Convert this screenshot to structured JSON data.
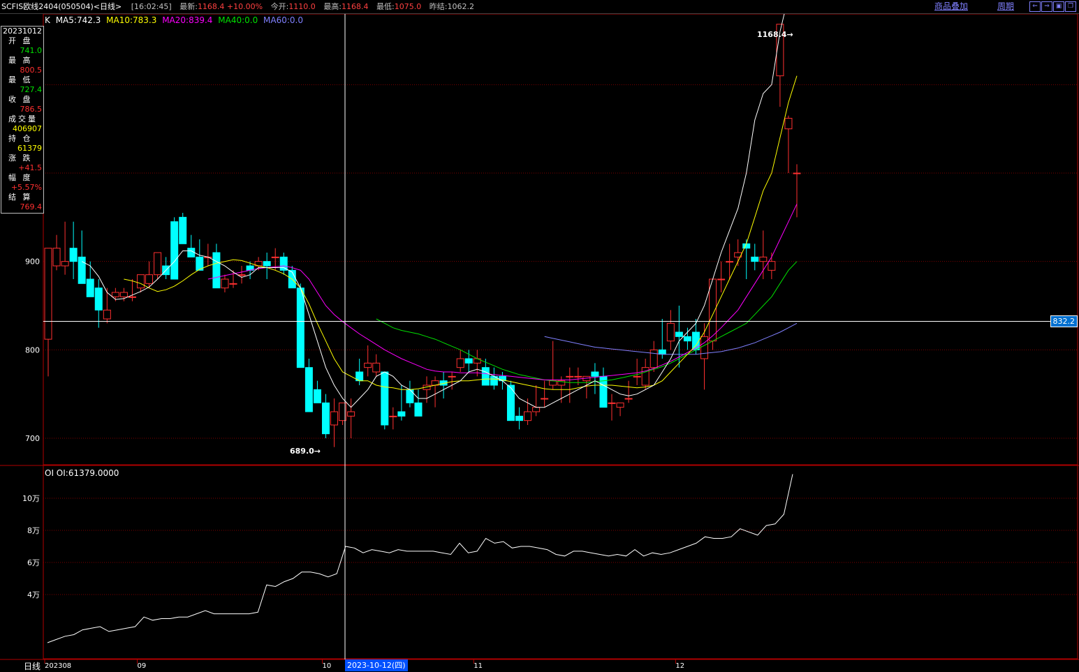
{
  "topbar": {
    "title": "SCFIS欧线2404(050504)<日线>",
    "time": "[16:02:45]",
    "latest_label": "最新:",
    "latest_value": "1168.4 +10.00%",
    "open_label": "今开:",
    "open_value": "1110.0",
    "high_label": "最高:",
    "high_value": "1168.4",
    "low_label": "最低:",
    "low_value": "1075.0",
    "prev_label": "昨结:",
    "prev_value": "1062.2",
    "link_overlay": "商品叠加",
    "link_period": "周期"
  },
  "infobox": {
    "date": "20231012",
    "fields": [
      {
        "label": "开 盘",
        "value": "741.0",
        "color": "green"
      },
      {
        "label": "最 高",
        "value": "800.5",
        "color": "red"
      },
      {
        "label": "最 低",
        "value": "727.4",
        "color": "green"
      },
      {
        "label": "收 盘",
        "value": "786.5",
        "color": "red"
      },
      {
        "label": "成交量",
        "value": "406907",
        "color": "yellow"
      },
      {
        "label": "持 仓",
        "value": "61379",
        "color": "yellow"
      },
      {
        "label": "涨 跌",
        "value": "+41.5",
        "color": "red"
      },
      {
        "label": "幅 度",
        "value": "+5.57%",
        "color": "red"
      },
      {
        "label": "结 算",
        "value": "769.4",
        "color": "red"
      }
    ]
  },
  "ma_legend": {
    "k": "K",
    "ma5": "MA5:742.3",
    "ma10": "MA10:783.3",
    "ma20": "MA20:839.4",
    "ma40": "MA40:0.0",
    "ma60": "MA60:0.0",
    "colors": {
      "ma5": "#ffffff",
      "ma10": "#ffff00",
      "ma20": "#ff00ff",
      "ma40": "#00e000",
      "ma60": "#8080ff"
    }
  },
  "oi_legend": "OI OI:61379.0000",
  "cursor_price": "832.2",
  "cursor_date": "2023-10-12(四)",
  "period_label": "日线",
  "max_label": "1168.4",
  "min_label": "689.0",
  "price_ticks": [
    "900",
    "800",
    "700"
  ],
  "oi_ticks": [
    "10万",
    "8万",
    "6万",
    "4万"
  ],
  "x_ticks": [
    "202308",
    "09",
    "10",
    "11",
    "12"
  ],
  "chart_data": {
    "type": "candlestick",
    "title": "",
    "candles": [
      [
        812,
        915,
        770,
        915
      ],
      [
        895,
        930,
        890,
        915
      ],
      [
        895,
        945,
        885,
        900
      ],
      [
        915,
        945,
        880,
        900
      ],
      [
        905,
        935,
        880,
        875
      ],
      [
        880,
        900,
        860,
        860
      ],
      [
        870,
        880,
        825,
        845
      ],
      [
        835,
        870,
        830,
        845
      ],
      [
        860,
        870,
        855,
        865
      ],
      [
        860,
        870,
        855,
        865
      ],
      [
        860,
        880,
        855,
        860
      ],
      [
        870,
        880,
        865,
        885
      ],
      [
        875,
        900,
        870,
        885
      ],
      [
        885,
        910,
        880,
        910
      ],
      [
        895,
        905,
        880,
        885
      ],
      [
        945,
        950,
        880,
        880
      ],
      [
        950,
        955,
        925,
        920
      ],
      [
        915,
        930,
        905,
        905
      ],
      [
        905,
        925,
        890,
        890
      ],
      [
        905,
        920,
        895,
        905
      ],
      [
        910,
        920,
        870,
        870
      ],
      [
        870,
        885,
        865,
        880
      ],
      [
        875,
        890,
        870,
        875
      ],
      [
        885,
        895,
        875,
        885
      ],
      [
        895,
        900,
        880,
        890
      ],
      [
        895,
        905,
        890,
        900
      ],
      [
        900,
        910,
        880,
        895
      ],
      [
        905,
        915,
        890,
        905
      ],
      [
        905,
        910,
        885,
        890
      ],
      [
        890,
        895,
        870,
        870
      ],
      [
        870,
        875,
        780,
        780
      ],
      [
        780,
        790,
        730,
        730
      ],
      [
        755,
        765,
        740,
        740
      ],
      [
        740,
        750,
        700,
        705
      ],
      [
        715,
        745,
        690,
        730
      ],
      [
        720,
        740,
        715,
        740
      ],
      [
        725,
        745,
        700,
        730
      ],
      [
        775,
        790,
        760,
        765
      ],
      [
        780,
        805,
        770,
        785
      ],
      [
        775,
        795,
        770,
        785
      ],
      [
        775,
        775,
        710,
        715
      ],
      [
        725,
        735,
        710,
        725
      ],
      [
        730,
        760,
        720,
        725
      ],
      [
        755,
        765,
        735,
        740
      ],
      [
        740,
        755,
        725,
        725
      ],
      [
        755,
        770,
        740,
        760
      ],
      [
        760,
        770,
        735,
        765
      ],
      [
        765,
        775,
        745,
        760
      ],
      [
        770,
        775,
        755,
        770
      ],
      [
        780,
        800,
        775,
        790
      ],
      [
        790,
        800,
        775,
        785
      ],
      [
        785,
        800,
        770,
        790
      ],
      [
        780,
        790,
        760,
        760
      ],
      [
        770,
        780,
        755,
        760
      ],
      [
        770,
        775,
        755,
        765
      ],
      [
        760,
        765,
        725,
        720
      ],
      [
        725,
        735,
        710,
        720
      ],
      [
        720,
        745,
        715,
        730
      ],
      [
        730,
        760,
        725,
        735
      ],
      [
        745,
        765,
        735,
        745
      ],
      [
        760,
        810,
        755,
        765
      ],
      [
        760,
        770,
        740,
        765
      ],
      [
        770,
        780,
        740,
        770
      ],
      [
        770,
        780,
        760,
        770
      ],
      [
        765,
        770,
        745,
        770
      ],
      [
        775,
        785,
        750,
        770
      ],
      [
        770,
        780,
        740,
        735
      ],
      [
        740,
        750,
        720,
        740
      ],
      [
        735,
        740,
        725,
        740
      ],
      [
        745,
        765,
        740,
        745
      ],
      [
        770,
        790,
        760,
        770
      ],
      [
        760,
        790,
        755,
        780
      ],
      [
        780,
        810,
        775,
        800
      ],
      [
        800,
        835,
        790,
        795
      ],
      [
        810,
        845,
        800,
        830
      ],
      [
        820,
        850,
        780,
        815
      ],
      [
        815,
        825,
        800,
        810
      ],
      [
        820,
        835,
        795,
        800
      ],
      [
        790,
        830,
        755,
        815
      ],
      [
        810,
        880,
        800,
        880
      ],
      [
        880,
        900,
        865,
        880
      ],
      [
        900,
        920,
        880,
        900
      ],
      [
        905,
        925,
        895,
        910
      ],
      [
        920,
        925,
        880,
        915
      ],
      [
        905,
        920,
        890,
        900
      ],
      [
        900,
        935,
        880,
        905
      ],
      [
        890,
        910,
        880,
        900
      ],
      [
        1110,
        1168.4,
        1075,
        1168.4
      ],
      [
        1050,
        1065,
        1000,
        1062
      ],
      [
        1000,
        1010,
        950,
        1000
      ]
    ],
    "ma5": [
      null,
      null,
      null,
      null,
      900,
      895,
      883,
      865,
      857,
      858,
      862,
      866,
      871,
      880,
      890,
      900,
      912,
      912,
      907,
      905,
      900,
      895,
      888,
      882,
      885,
      893,
      893,
      893,
      893,
      888,
      870,
      840,
      810,
      780,
      760,
      745,
      735,
      745,
      755,
      770,
      775,
      770,
      760,
      755,
      745,
      745,
      750,
      755,
      760,
      765,
      775,
      778,
      775,
      770,
      765,
      757,
      745,
      740,
      735,
      735,
      740,
      745,
      750,
      755,
      760,
      765,
      760,
      755,
      750,
      748,
      750,
      755,
      760,
      775,
      790,
      810,
      820,
      830,
      850,
      880,
      910,
      935,
      960,
      1000,
      1060,
      1090,
      1100,
      1160,
      1200,
      1210
    ],
    "ma10": [
      null,
      null,
      null,
      null,
      null,
      null,
      null,
      null,
      null,
      880,
      878,
      875,
      870,
      866,
      868,
      872,
      878,
      885,
      891,
      895,
      898,
      900,
      902,
      901,
      898,
      895,
      893,
      890,
      886,
      880,
      870,
      852,
      830,
      810,
      790,
      775,
      770,
      765,
      765,
      760,
      758,
      757,
      755,
      755,
      756,
      758,
      760,
      762,
      764,
      765,
      765,
      766,
      767,
      767,
      766,
      764,
      762,
      760,
      758,
      756,
      755,
      755,
      755,
      757,
      759,
      760,
      760,
      760,
      759,
      758,
      757,
      758,
      760,
      765,
      775,
      785,
      795,
      805,
      820,
      840,
      860,
      880,
      900,
      920,
      950,
      980,
      1000,
      1040,
      1080,
      1110
    ],
    "ma20": [
      null,
      null,
      null,
      null,
      null,
      null,
      null,
      null,
      null,
      null,
      null,
      null,
      null,
      null,
      null,
      null,
      null,
      null,
      null,
      880,
      882,
      884,
      886,
      888,
      890,
      892,
      893,
      894,
      895,
      893,
      890,
      880,
      865,
      850,
      840,
      832,
      825,
      818,
      812,
      806,
      800,
      795,
      790,
      786,
      782,
      778,
      776,
      775,
      775,
      774,
      774,
      774,
      773,
      772,
      771,
      770,
      769,
      768,
      767,
      766,
      766,
      766,
      766,
      767,
      768,
      769,
      770,
      771,
      772,
      773,
      774,
      776,
      779,
      783,
      787,
      792,
      797,
      802,
      808,
      816,
      825,
      835,
      845,
      860,
      875,
      890,
      905,
      925,
      945,
      965
    ],
    "ma40": [
      null,
      null,
      null,
      null,
      null,
      null,
      null,
      null,
      null,
      null,
      null,
      null,
      null,
      null,
      null,
      null,
      null,
      null,
      null,
      null,
      null,
      null,
      null,
      null,
      null,
      null,
      null,
      null,
      null,
      null,
      null,
      null,
      null,
      null,
      null,
      null,
      null,
      null,
      null,
      835,
      830,
      825,
      822,
      820,
      818,
      815,
      812,
      808,
      804,
      800,
      795,
      790,
      786,
      782,
      778,
      775,
      772,
      770,
      768,
      766,
      765,
      764,
      763,
      763,
      763,
      764,
      765,
      766,
      768,
      770,
      772,
      775,
      778,
      781,
      785,
      790,
      795,
      800,
      805,
      810,
      815,
      820,
      825,
      830,
      840,
      850,
      860,
      875,
      890,
      900
    ],
    "ma60": [
      null,
      null,
      null,
      null,
      null,
      null,
      null,
      null,
      null,
      null,
      null,
      null,
      null,
      null,
      null,
      null,
      null,
      null,
      null,
      null,
      null,
      null,
      null,
      null,
      null,
      null,
      null,
      null,
      null,
      null,
      null,
      null,
      null,
      null,
      null,
      null,
      null,
      null,
      null,
      null,
      null,
      null,
      null,
      null,
      null,
      null,
      null,
      null,
      null,
      null,
      null,
      null,
      null,
      null,
      null,
      null,
      null,
      null,
      null,
      815,
      813,
      811,
      809,
      807,
      805,
      803,
      802,
      801,
      800,
      799,
      798,
      797,
      796,
      795,
      795,
      795,
      795,
      795,
      796,
      797,
      798,
      800,
      802,
      805,
      808,
      812,
      816,
      820,
      825,
      830
    ],
    "oi": [
      10000,
      12000,
      14000,
      15000,
      18000,
      19000,
      20000,
      17000,
      18000,
      19000,
      20000,
      26000,
      24000,
      25000,
      25000,
      26000,
      26000,
      28000,
      30000,
      28000,
      28000,
      28000,
      28000,
      28000,
      29000,
      46000,
      45000,
      48000,
      50000,
      54000,
      54000,
      53000,
      51000,
      53000,
      70000,
      69000,
      66000,
      68000,
      67000,
      66000,
      68000,
      67000,
      67000,
      67000,
      67000,
      66000,
      65000,
      72000,
      66000,
      67000,
      75000,
      72000,
      73000,
      69000,
      70000,
      70000,
      69000,
      68000,
      65000,
      64000,
      67000,
      67000,
      66000,
      65000,
      64000,
      65000,
      64000,
      68000,
      64000,
      66000,
      65000,
      66000,
      68000,
      70000,
      72000,
      76000,
      75000,
      75000,
      76000,
      81000,
      79000,
      77000,
      83000,
      84000,
      90000,
      115000
    ],
    "ylim": [
      670,
      1180
    ],
    "oi_ylim": [
      0,
      120000
    ],
    "grid": true,
    "up_color": "#ff3030",
    "down_color": "#00ffff"
  }
}
